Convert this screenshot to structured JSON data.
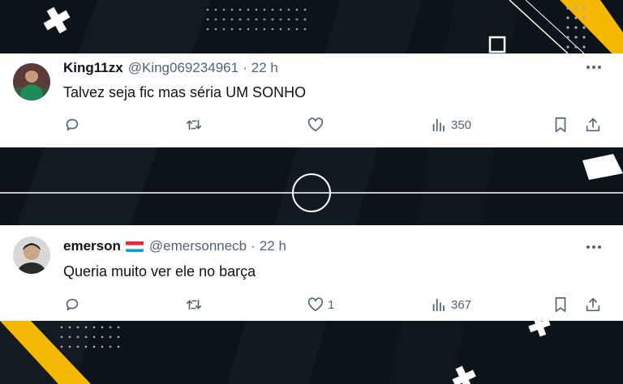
{
  "tweets": [
    {
      "name": "King11zx",
      "handle": "@King069234961",
      "sep": "·",
      "time": "22 h",
      "text": "Talvez seja fic mas séria UM SONHO",
      "likes": "",
      "views": "350",
      "avatar_icon": "goalkeeper-avatar"
    },
    {
      "name": "emerson",
      "flag_icon": "luxembourg-flag-icon",
      "handle": "@emersonnecb",
      "sep": "·",
      "time": "22 h",
      "text": "Queria muito ver ele no barça",
      "likes": "1",
      "views": "367",
      "avatar_icon": "person-avatar"
    }
  ],
  "colors": {
    "background": "#0d1419",
    "accent_yellow": "#f5b800",
    "card": "#ffffff",
    "text_primary": "#0f1419",
    "text_secondary": "#536471"
  }
}
